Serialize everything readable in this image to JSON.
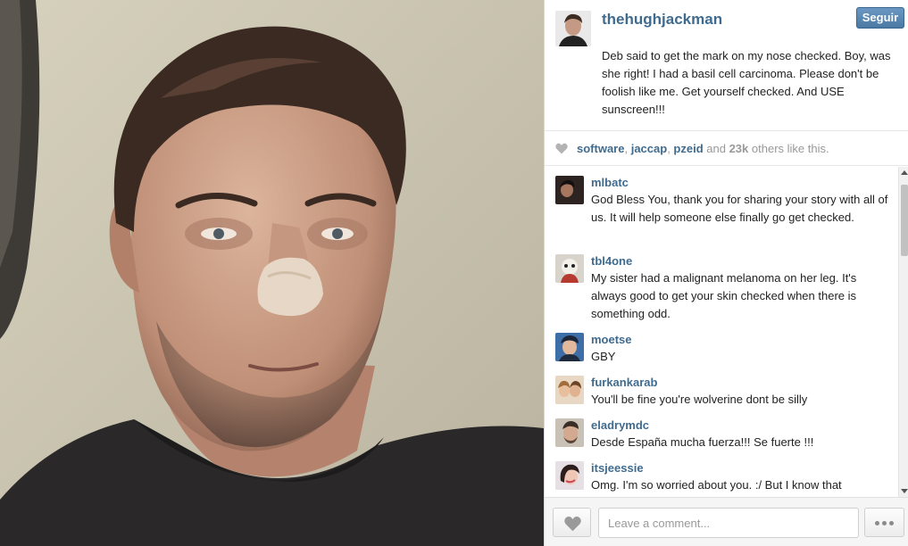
{
  "post": {
    "username": "thehughjackman",
    "follow_label": "Seguir",
    "caption": "Deb said to get the mark on my nose checked. Boy, was she right! I had a basil cell carcinoma. Please don't be foolish like me. Get yourself checked. And USE sunscreen!!!"
  },
  "likes": {
    "users": [
      "software",
      "jaccap",
      "pzeid"
    ],
    "sep1": ", ",
    "sep2": ", ",
    "and": " and ",
    "count": "23k",
    "suffix": " others like this."
  },
  "comments": [
    {
      "user": "mlbatc",
      "text": "God Bless You, thank you for sharing your story with all of us. It will help someone else finally go get checked."
    },
    {
      "user": "tbl4one",
      "text": "My sister had a malignant melanoma on her leg. It's always good to get your skin checked when there is something odd."
    },
    {
      "user": "moetse",
      "text": "GBY"
    },
    {
      "user": "furkankarab",
      "text": "You'll be fine you're wolverine dont be silly"
    },
    {
      "user": "eladrymdc",
      "text": "Desde España mucha fuerza!!! Se fuerte !!!"
    },
    {
      "user": "itsjeessie",
      "text": "Omg. I'm so worried about you. :/ But I know that"
    }
  ],
  "footer": {
    "comment_placeholder": "Leave a comment..."
  },
  "icons": {
    "like": "heart-icon",
    "more": "more-dots-icon"
  },
  "colors": {
    "link": "#3f6b8f",
    "follow_button": "#5585b3"
  }
}
